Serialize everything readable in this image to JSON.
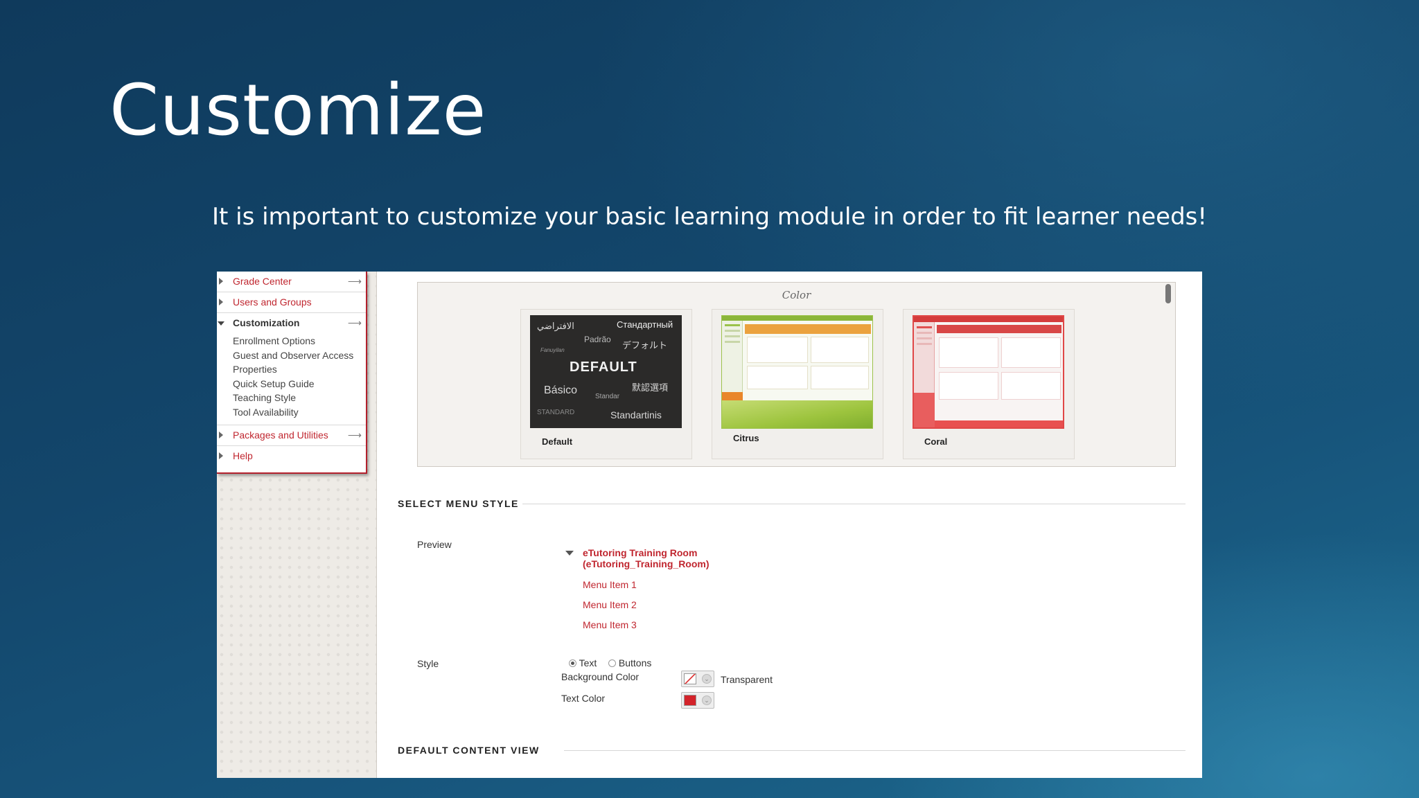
{
  "slide": {
    "title": "Customize",
    "subtitle": "It is important to customize your basic learning module in order to fit learner needs!"
  },
  "sidebar": {
    "grade_center": "Grade Center",
    "users_groups": "Users and Groups",
    "customization": "Customization",
    "customization_items": [
      "Enrollment Options",
      "Guest and Observer Access",
      "Properties",
      "Quick Setup Guide",
      "Teaching Style",
      "Tool Availability"
    ],
    "packages": "Packages and Utilities",
    "help": "Help",
    "arrow_glyph": "⟶"
  },
  "color_section": {
    "label": "Color",
    "themes": [
      "Default",
      "Citrus",
      "Coral"
    ],
    "default_words": {
      "arabic": "الافتراضي",
      "russian": "Стандартный",
      "portuguese": "Padrão",
      "japanese": "デフォルト",
      "small": "Fanuyilan",
      "default": "DEFAULT",
      "spanish": "Básico",
      "chinese": "默認選項",
      "standar": "Standar",
      "standard": "STANDARD",
      "lithuanian": "Standartinis"
    }
  },
  "menu_style": {
    "heading": "SELECT MENU STYLE",
    "preview_label": "Preview",
    "preview_title_line1": "eTutoring Training Room",
    "preview_title_line2": "(eTutoring_Training_Room)",
    "preview_items": [
      "Menu Item 1",
      "Menu Item 2",
      "Menu Item 3"
    ],
    "style_label": "Style",
    "style_options": [
      "Text",
      "Buttons"
    ],
    "background_color_label": "Background Color",
    "background_value": "Transparent",
    "text_color_label": "Text Color",
    "text_color": "#d3232a"
  },
  "content_view": {
    "heading": "DEFAULT CONTENT VIEW"
  }
}
